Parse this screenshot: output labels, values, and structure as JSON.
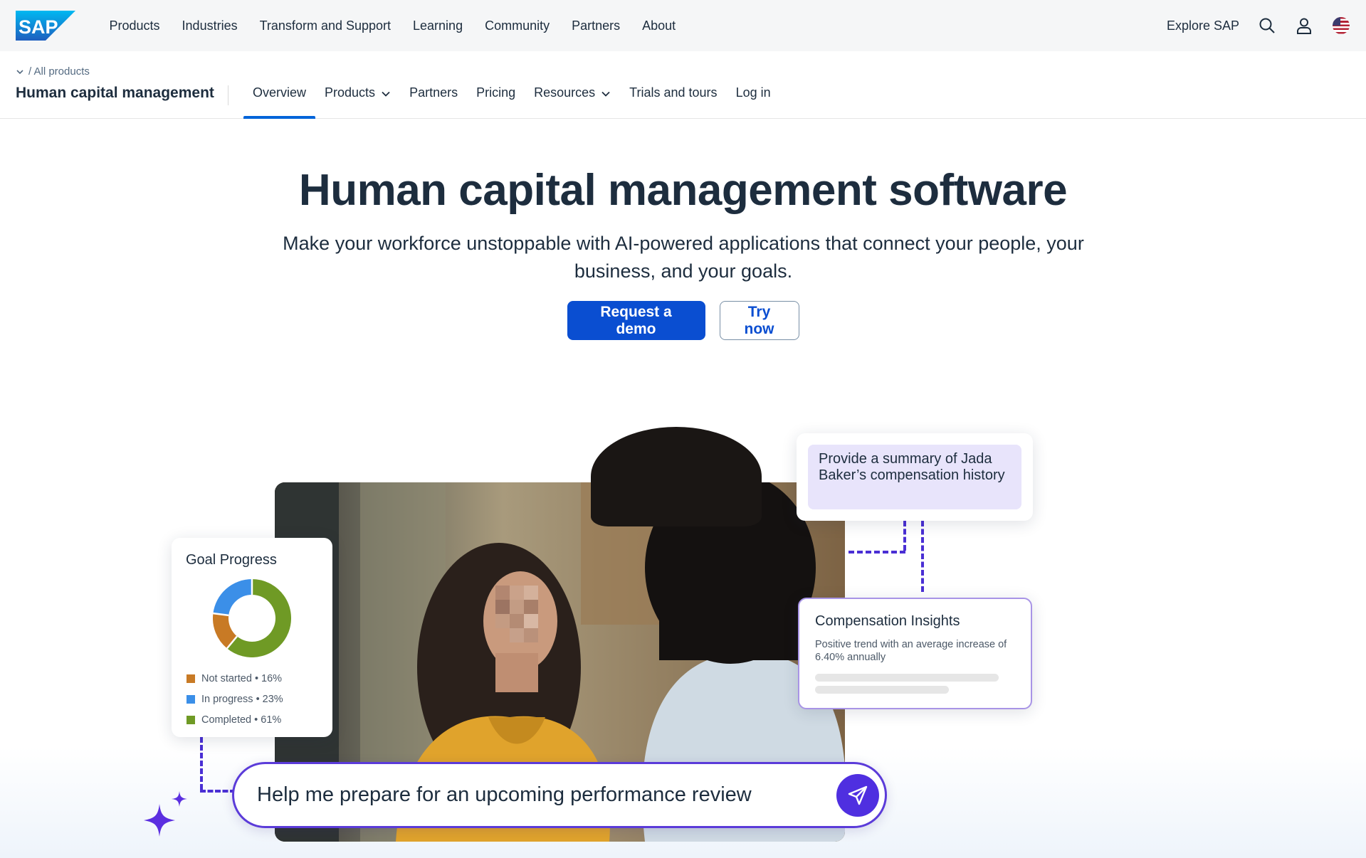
{
  "brand": {
    "logo_text": "SAP",
    "accent": "#0a4ed1",
    "ai_accent": "#4f2fe0"
  },
  "topnav": {
    "links": [
      "Products",
      "Industries",
      "Transform and Support",
      "Learning",
      "Community",
      "Partners",
      "About"
    ],
    "explore": "Explore SAP",
    "icons": [
      "search-icon",
      "user-icon",
      "us-flag-icon"
    ]
  },
  "subnav": {
    "breadcrumb": "/ All products",
    "product_name": "Human capital management",
    "tabs": [
      {
        "label": "Overview",
        "active": true,
        "dropdown": false
      },
      {
        "label": "Products",
        "active": false,
        "dropdown": true
      },
      {
        "label": "Partners",
        "active": false,
        "dropdown": false
      },
      {
        "label": "Pricing",
        "active": false,
        "dropdown": false
      },
      {
        "label": "Resources",
        "active": false,
        "dropdown": true
      },
      {
        "label": "Trials and tours",
        "active": false,
        "dropdown": false
      },
      {
        "label": "Log in",
        "active": false,
        "dropdown": false
      }
    ]
  },
  "hero": {
    "title": "Human capital management software",
    "subtitle": "Make your workforce unstoppable with AI-powered applications that connect your people, your business, and your goals.",
    "primary_button": "Request a demo",
    "secondary_button": "Try now"
  },
  "goal_card": {
    "title": "Goal Progress",
    "items": [
      {
        "label": "Not started • 16%",
        "value": 16,
        "color": "#c87a25"
      },
      {
        "label": "In progress • 23%",
        "value": 23,
        "color": "#3b8fe8"
      },
      {
        "label": "Completed • 61%",
        "value": 61,
        "color": "#6f9a25"
      }
    ]
  },
  "prompt_card": {
    "text": "Provide a summary of Jada Baker’s compensation history"
  },
  "comp_card": {
    "title": "Compensation Insights",
    "text": "Positive trend with an average increase of 6.40% annually"
  },
  "chat": {
    "placeholder": "Help me prepare for an upcoming performance review"
  }
}
